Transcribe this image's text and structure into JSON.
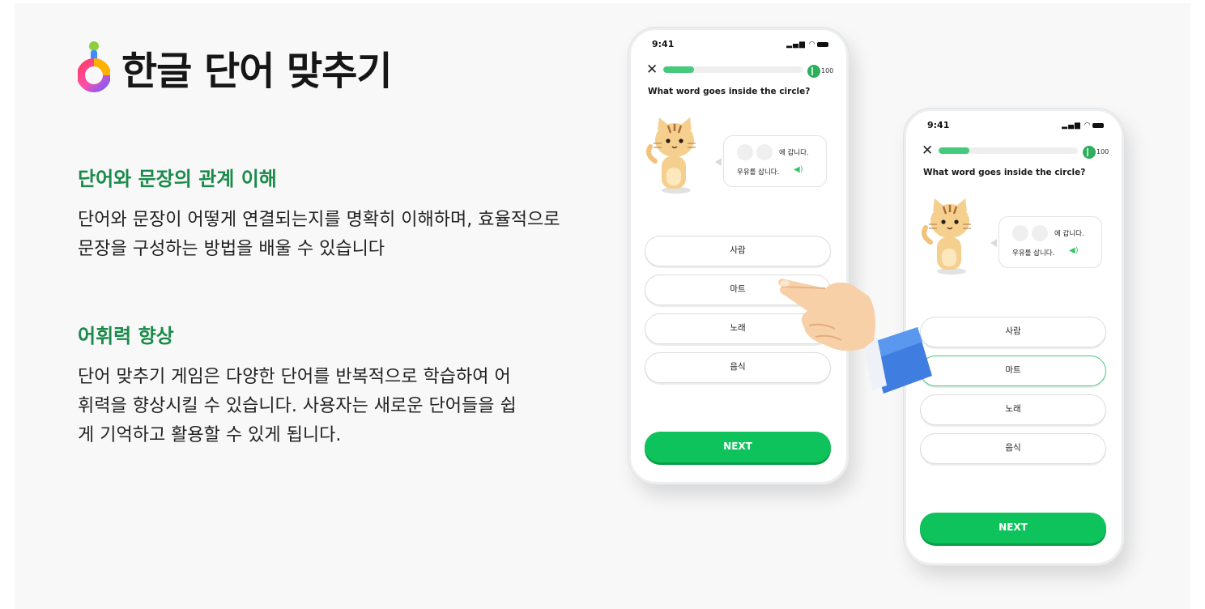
{
  "app": {
    "title": "한글 단어 맞추기",
    "logo_icon": "hangul-logo-icon"
  },
  "sections": [
    {
      "heading": "단어와 문장의 관계 이해",
      "body": "단어와 문장이 어떻게 연결되는지를 명확히 이해하며, 효율적으로 문장을 구성하는 방법을 배울 수 있습니다"
    },
    {
      "heading": "어휘력 향상",
      "body": "단어 맞추기 게임은 다양한 단어를 반복적으로 학습하여 어휘력을 향상시킬 수 있습니다. 사용자는 새로운 단어들을 쉽게 기억하고 활용할 수 있게 됩니다."
    }
  ],
  "colors": {
    "accent_green": "#1a8a4a",
    "button_green": "#0fc35c",
    "progress_green": "#45c97d"
  },
  "phones": [
    {
      "status_time": "9:41",
      "status_icons": "signal-wifi-battery",
      "progress": 0.22,
      "xp": "100",
      "question": "What word goes inside the circle?",
      "bubble_line1": "에 갑니다.",
      "bubble_line2": "우유를 삽니다.",
      "options": [
        "사람",
        "마트",
        "노래",
        "음식"
      ],
      "selected_index": null,
      "next_label": "NEXT"
    },
    {
      "status_time": "9:41",
      "status_icons": "signal-wifi-battery",
      "progress": 0.22,
      "xp": "100",
      "question": "What word goes inside the circle?",
      "bubble_line1": "에 갑니다.",
      "bubble_line2": "우유를 삽니다.",
      "options": [
        "사람",
        "마트",
        "노래",
        "음식"
      ],
      "selected_index": 1,
      "next_label": "NEXT"
    }
  ],
  "pointer_icon": "pointing-hand-icon"
}
